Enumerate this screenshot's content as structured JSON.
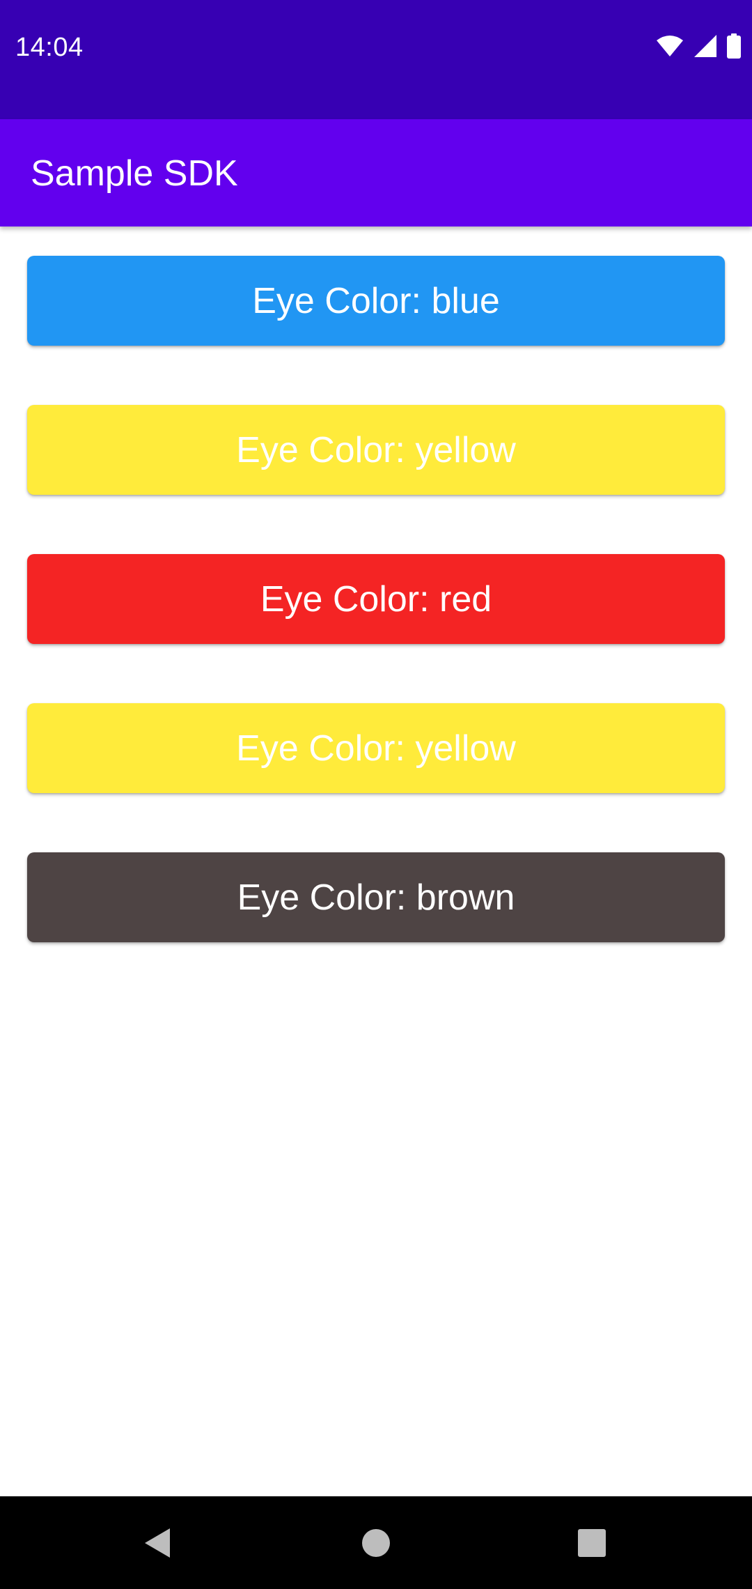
{
  "status_bar": {
    "time": "14:04",
    "icons": [
      "wifi-icon",
      "signal-icon",
      "battery-icon"
    ],
    "background": "#3700b3"
  },
  "app_bar": {
    "title": "Sample SDK",
    "background": "#6200ee"
  },
  "buttons": [
    {
      "label": "Eye Color: blue",
      "color": "#2196f3"
    },
    {
      "label": "Eye Color: yellow",
      "color": "#ffeb3b"
    },
    {
      "label": "Eye Color: red",
      "color": "#f42424"
    },
    {
      "label": "Eye Color: yellow",
      "color": "#ffeb3b"
    },
    {
      "label": "Eye Color: brown",
      "color": "#4e4444"
    }
  ],
  "nav_bar": {
    "icons": [
      "back-icon",
      "home-icon",
      "recents-icon"
    ]
  }
}
